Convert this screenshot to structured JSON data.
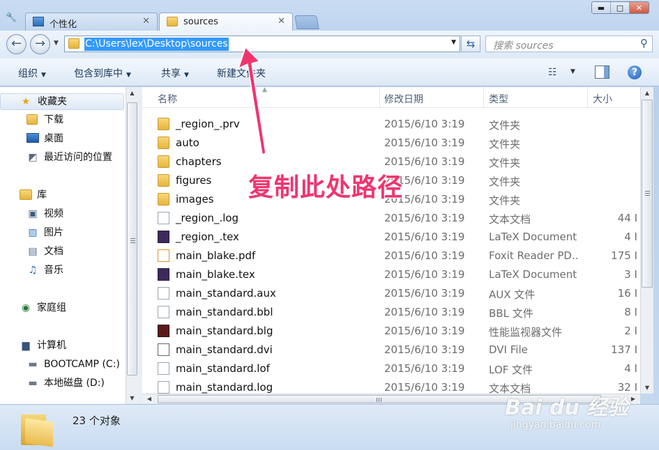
{
  "tabs": [
    {
      "label": "个性化",
      "active": false
    },
    {
      "label": "sources",
      "active": true
    }
  ],
  "window_controls": {
    "minimize": "▬",
    "maximize": "□",
    "close": "✕"
  },
  "address": {
    "path": "C:\\Users\\lex\\Desktop\\sources"
  },
  "search": {
    "placeholder": "搜索 sources"
  },
  "toolbar": {
    "organize": "组织",
    "include_library": "包含到库中",
    "share": "共享",
    "new_folder": "新建文件夹"
  },
  "nav": {
    "favorites": "收藏夹",
    "downloads": "下载",
    "desktop": "桌面",
    "recent": "最近访问的位置",
    "libraries": "库",
    "videos": "视频",
    "pictures": "图片",
    "documents": "文档",
    "music": "音乐",
    "homegroup": "家庭组",
    "computer": "计算机",
    "bootcamp": "BOOTCAMP (C:)",
    "localdisk": "本地磁盘 (D:)"
  },
  "columns": {
    "name": "名称",
    "date": "修改日期",
    "type": "类型",
    "size": "大小"
  },
  "files": [
    {
      "name": "_region_.prv",
      "date": "2015/6/10 3:19",
      "type": "文件夹",
      "size": "",
      "icon": "folder"
    },
    {
      "name": "auto",
      "date": "2015/6/10 3:19",
      "type": "文件夹",
      "size": "",
      "icon": "folder"
    },
    {
      "name": "chapters",
      "date": "2015/6/10 3:19",
      "type": "文件夹",
      "size": "",
      "icon": "folder"
    },
    {
      "name": "figures",
      "date": "2015/6/10 3:19",
      "type": "文件夹",
      "size": "",
      "icon": "folder"
    },
    {
      "name": "images",
      "date": "2015/6/10 3:19",
      "type": "文件夹",
      "size": "",
      "icon": "folder"
    },
    {
      "name": "_region_.log",
      "date": "2015/6/10 3:19",
      "type": "文本文档",
      "size": "44 I",
      "icon": "doc"
    },
    {
      "name": "_region_.tex",
      "date": "2015/6/10 3:19",
      "type": "LaTeX Document",
      "size": "4 I",
      "icon": "tex"
    },
    {
      "name": "main_blake.pdf",
      "date": "2015/6/10 3:19",
      "type": "Foxit Reader PD...",
      "size": "175 I",
      "icon": "pdf"
    },
    {
      "name": "main_blake.tex",
      "date": "2015/6/10 3:19",
      "type": "LaTeX Document",
      "size": "3 I",
      "icon": "tex"
    },
    {
      "name": "main_standard.aux",
      "date": "2015/6/10 3:19",
      "type": "AUX 文件",
      "size": "16 I",
      "icon": "doc"
    },
    {
      "name": "main_standard.bbl",
      "date": "2015/6/10 3:19",
      "type": "BBL 文件",
      "size": "8 I",
      "icon": "doc"
    },
    {
      "name": "main_standard.blg",
      "date": "2015/6/10 3:19",
      "type": "性能监视器文件",
      "size": "2 I",
      "icon": "blg"
    },
    {
      "name": "main_standard.dvi",
      "date": "2015/6/10 3:19",
      "type": "DVI File",
      "size": "137 I",
      "icon": "dvi"
    },
    {
      "name": "main_standard.lof",
      "date": "2015/6/10 3:19",
      "type": "LOF 文件",
      "size": "4 I",
      "icon": "doc"
    },
    {
      "name": "main_standard.log",
      "date": "2015/6/10 3:19",
      "type": "文本文档",
      "size": "32 I",
      "icon": "doc"
    }
  ],
  "status": {
    "count": "23 个对象"
  },
  "annotation": {
    "text": "复制此处路径",
    "color": "#f0356e"
  },
  "watermark": {
    "brand": "Bai du 经验",
    "url": "jingyan.baidu.com"
  }
}
